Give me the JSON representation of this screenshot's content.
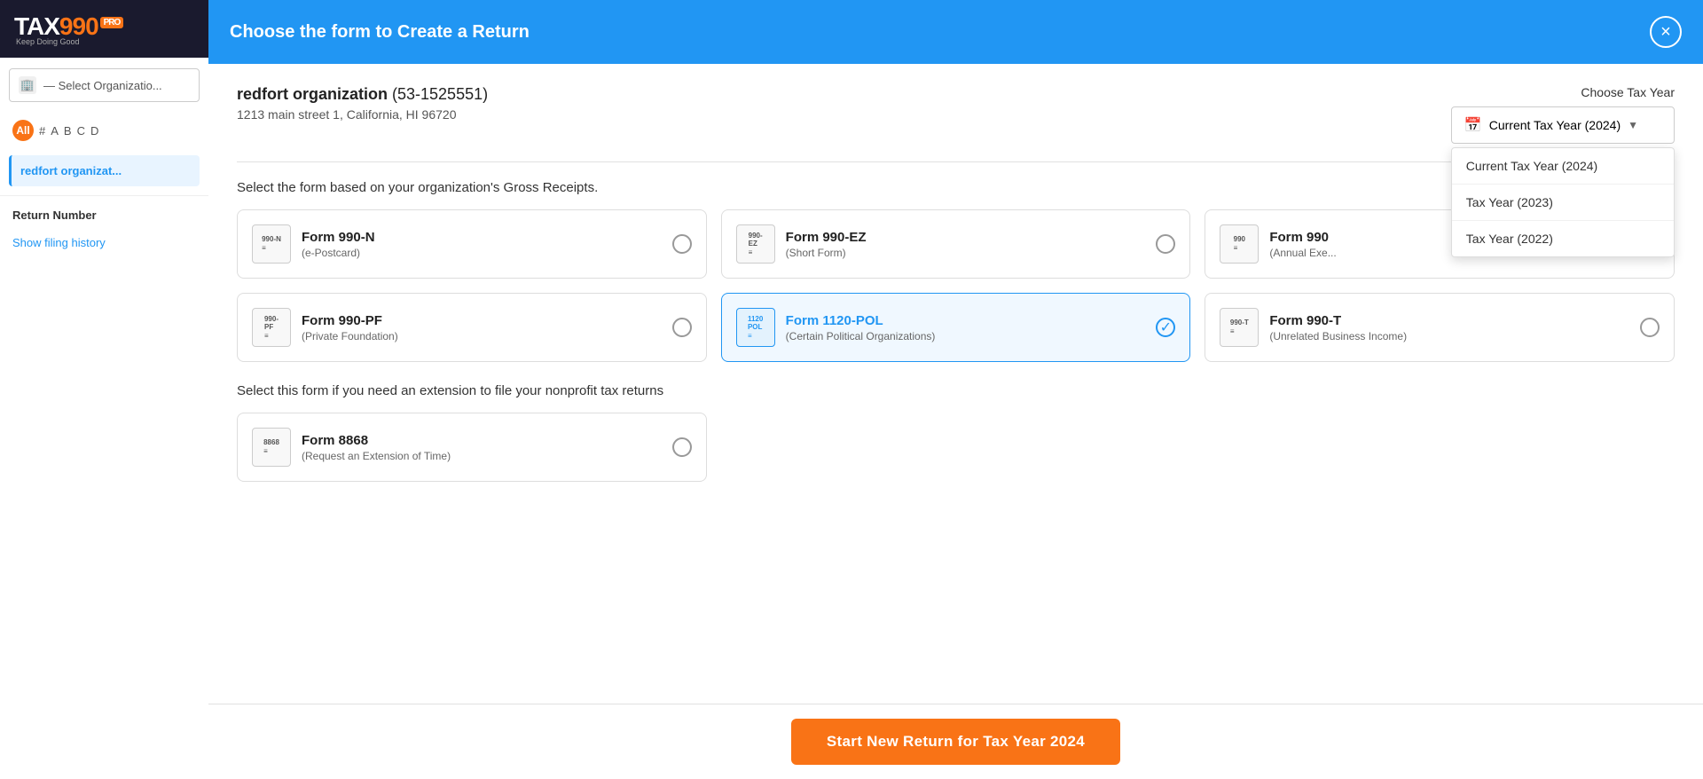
{
  "app": {
    "name": "TAX990",
    "pro_badge": "PRO",
    "tagline": "Keep Doing Good"
  },
  "sidebar": {
    "select_org_placeholder": "— Select Organizatio...",
    "alpha_nav": [
      "All",
      "#",
      "A",
      "B",
      "C",
      "D"
    ],
    "org_item": "redfort organizat...",
    "return_number_label": "Return Number",
    "show_filing_history": "Show filing history"
  },
  "modal": {
    "title": "Choose the form to Create a Return",
    "close_label": "×",
    "org_name": "redfort organization",
    "org_ein": "(53-1525551)",
    "org_address": "1213 main street 1, California, HI 96720",
    "tax_year_label": "Choose Tax Year",
    "tax_year_selected": "Current Tax Year (2024)",
    "tax_year_dropdown_options": [
      "Current Tax Year (2024)",
      "Tax Year (2023)",
      "Tax Year (2022)"
    ],
    "gross_receipts_label": "Select the form based on your organization's Gross Receipts.",
    "forms": [
      {
        "id": "990-N",
        "badge": "990-N",
        "name": "Form 990-N",
        "sub": "(e-Postcard)",
        "selected": false
      },
      {
        "id": "990-EZ",
        "badge": "990-EZ",
        "name": "Form 990-EZ",
        "sub": "(Short Form)",
        "selected": false
      },
      {
        "id": "990",
        "badge": "990",
        "name": "Form 990",
        "sub": "(Annual Exe...",
        "selected": false
      },
      {
        "id": "990-PF",
        "badge": "990-PF",
        "name": "Form 990-PF",
        "sub": "(Private Foundation)",
        "selected": false
      },
      {
        "id": "1120-POL",
        "badge": "1120 POL",
        "name": "Form 1120-POL",
        "sub": "(Certain Political Organizations)",
        "selected": true
      },
      {
        "id": "990-T",
        "badge": "990-T",
        "name": "Form 990-T",
        "sub": "(Unrelated Business Income)",
        "selected": false
      }
    ],
    "extension_label": "Select this form if you need an extension to file your nonprofit tax returns",
    "extension_form": {
      "id": "8868",
      "badge": "8868",
      "name": "Form 8868",
      "sub": "(Request an Extension of Time)",
      "selected": false
    },
    "start_button": "Start New Return for Tax Year 2024"
  }
}
